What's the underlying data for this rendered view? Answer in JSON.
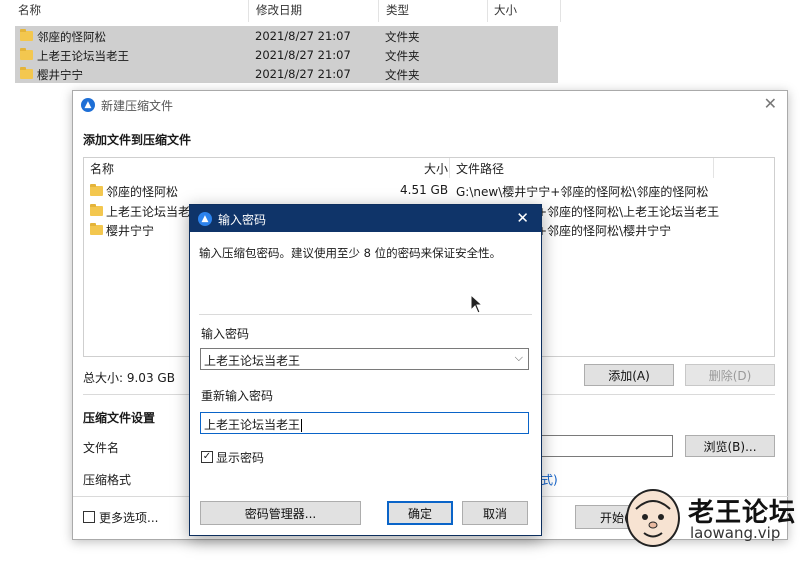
{
  "explorer": {
    "columns": [
      "名称",
      "修改日期",
      "类型",
      "大小"
    ],
    "rows": [
      {
        "name": "邻座的怪阿松",
        "date": "2021/8/27 21:07",
        "type": "文件夹"
      },
      {
        "name": "上老王论坛当老王",
        "date": "2021/8/27 21:07",
        "type": "文件夹"
      },
      {
        "name": "樱井宁宁",
        "date": "2021/8/27 21:07",
        "type": "文件夹"
      }
    ]
  },
  "compress_dialog": {
    "title": "新建压缩文件",
    "add_section": "添加文件到压缩文件",
    "list_headers": {
      "name": "名称",
      "size": "大小",
      "path": "文件路径"
    },
    "items": [
      {
        "name": "邻座的怪阿松",
        "size": "4.51 GB",
        "path": "G:\\new\\樱井宁宁+邻座的怪阿松\\邻座的怪阿松"
      },
      {
        "name": "上老王论坛当老王",
        "size": "",
        "path": "+邻座的怪阿松\\上老王论坛当老王"
      },
      {
        "name": "樱井宁宁",
        "size": "",
        "path": "+邻座的怪阿松\\樱井宁宁"
      }
    ],
    "total_size": "总大小: 9.03 GB",
    "add_button": "添加(A)",
    "delete_button": "删除(D)",
    "settings_section": "压缩文件设置",
    "filename_label": "文件名",
    "browse_button": "浏览(B)...",
    "format_label": "压缩格式",
    "format_link_tail": "式)",
    "more_options": "更多选项...",
    "start_button": "开始(",
    "more_checked": false
  },
  "password_dialog": {
    "title": "输入密码",
    "description": "输入压缩包密码。建议使用至少 8 位的密码来保证安全性。",
    "password_label": "输入密码",
    "password_value": "上老王论坛当老王",
    "confirm_label": "重新输入密码",
    "confirm_value": "上老王论坛当老王",
    "show_password_label": "显示密码",
    "show_password_checked": true,
    "manager_button": "密码管理器...",
    "ok_button": "确定",
    "cancel_button": "取消"
  },
  "watermark": {
    "title": "老王论坛",
    "url": "laowang.vip"
  },
  "colors": {
    "title_bar": "#0f3469",
    "accent": "#1e6fd6",
    "folder": "#f3c74f",
    "selection": "#cfcfcf"
  }
}
